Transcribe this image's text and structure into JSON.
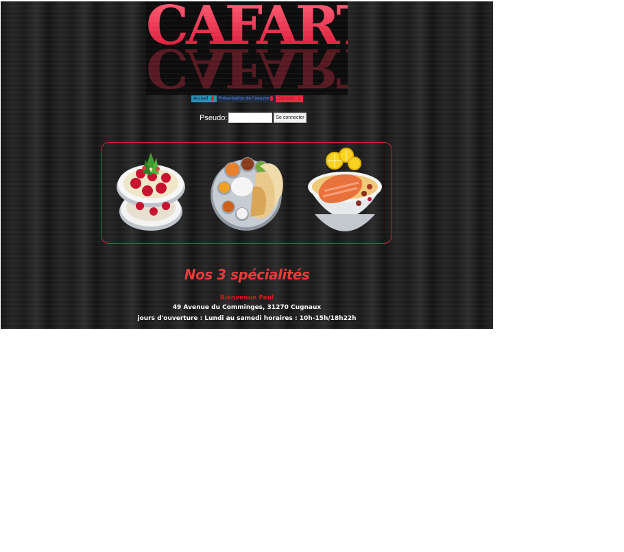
{
  "logo": {
    "text": "CAFART",
    "colors": {
      "top": "#ff6178",
      "bottom": "#d71433"
    }
  },
  "nav": {
    "tabs": [
      {
        "label": "Accueil",
        "color": "#2c8fb8"
      },
      {
        "label": "Présentation de l'oeuvre",
        "color": "#1e2a3a"
      },
      {
        "label": "Contact",
        "color": "#e02f40"
      }
    ]
  },
  "login": {
    "label": "Pseudo:",
    "value": "",
    "button_label": "Se connecter"
  },
  "carousel": {
    "dishes": [
      {
        "icon": "carpaccio-plate-icon"
      },
      {
        "icon": "thali-platter-icon"
      },
      {
        "icon": "salmon-bowl-icon"
      }
    ]
  },
  "main": {
    "heading": "Nos 3 spécialités",
    "welcome": "Bienvenue Paul",
    "address": "49 Avenue du Comminges, 31270 Cugnaux",
    "hours": "jours d'ouverture : Lundi au samedi horaires : 10h-15h/18h22h"
  },
  "colors": {
    "accent": "#d1262e",
    "background": "#1e1e1e"
  }
}
